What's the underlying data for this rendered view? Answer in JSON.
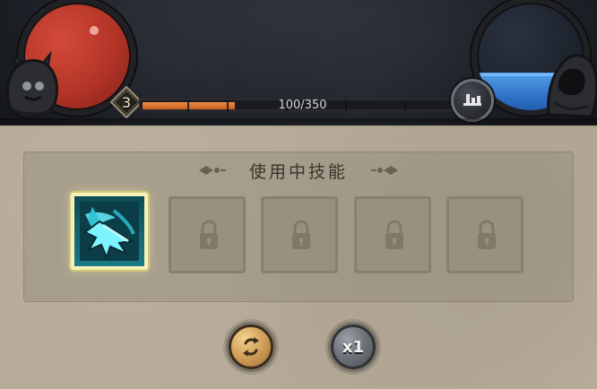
{
  "hud": {
    "level": "3",
    "xp_text": "100/350",
    "xp_fill_fraction": 0.2857,
    "hp_orb_color": "#b23427",
    "mana_orb_fill_fraction": 0.4,
    "mana_orb_color": "#2d6fc6"
  },
  "skills_panel": {
    "title": "使用中技能",
    "slots": [
      {
        "state": "active",
        "icon": "ice-spear-icon"
      },
      {
        "state": "locked",
        "icon": "lock-icon"
      },
      {
        "state": "locked",
        "icon": "lock-icon"
      },
      {
        "state": "locked",
        "icon": "lock-icon"
      },
      {
        "state": "locked",
        "icon": "lock-icon"
      }
    ]
  },
  "controls": {
    "refresh_icon": "refresh-icon",
    "speed_label": "x1"
  },
  "colors": {
    "panel_bg": "#b6ab98",
    "panel_text": "#3a342d",
    "active_border": "#f7f1b9",
    "xp_fill": "#f08c45",
    "button_gold": "#d4a35c"
  }
}
